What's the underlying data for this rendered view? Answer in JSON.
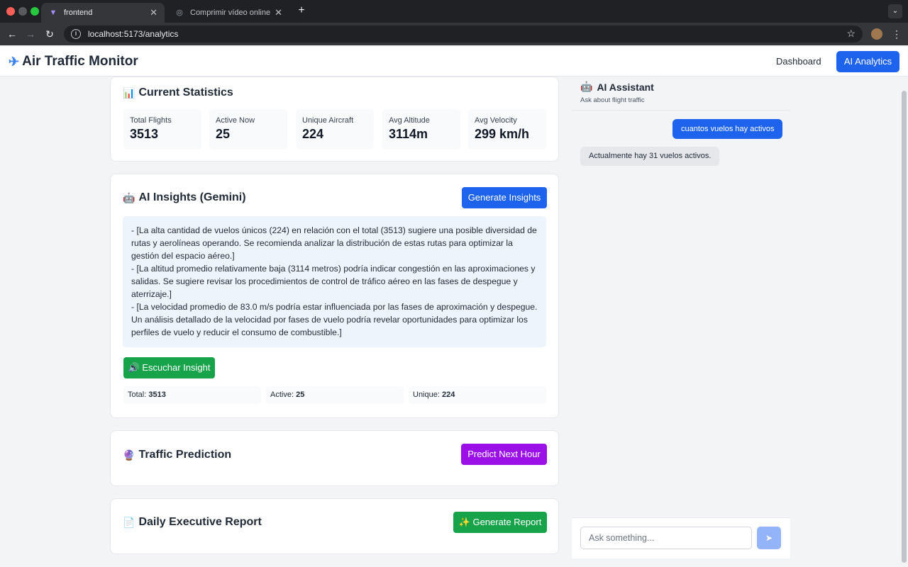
{
  "browser": {
    "tabs": [
      {
        "label": "frontend",
        "active": true
      },
      {
        "label": "Comprimir vídeo online — Re",
        "active": false
      }
    ],
    "url": "localhost:5173/analytics"
  },
  "header": {
    "brand": "Air Traffic Monitor",
    "nav": [
      {
        "label": "Dashboard",
        "active": false
      },
      {
        "label": "AI Analytics",
        "active": true
      }
    ]
  },
  "stats": {
    "title": "Current Statistics",
    "items": [
      {
        "label": "Total Flights",
        "value": "3513"
      },
      {
        "label": "Active Now",
        "value": "25"
      },
      {
        "label": "Unique Aircraft",
        "value": "224"
      },
      {
        "label": "Avg Altitude",
        "value": "3114m"
      },
      {
        "label": "Avg Velocity",
        "value": "299 km/h"
      }
    ]
  },
  "insights": {
    "title": "AI Insights (Gemini)",
    "generate_label": "Generate Insights",
    "lines": [
      "- [La alta cantidad de vuelos únicos (224) en relación con el total (3513) sugiere una posible diversidad de rutas y aerolíneas operando. Se recomienda analizar la distribución de estas rutas para optimizar la gestión del espacio aéreo.]",
      "- [La altitud promedio relativamente baja (3114 metros) podría indicar congestión en las aproximaciones y salidas. Se sugiere revisar los procedimientos de control de tráfico aéreo en las fases de despegue y aterrizaje.]",
      "- [La velocidad promedio de 83.0 m/s podría estar influenciada por las fases de aproximación y despegue. Un análisis detallado de la velocidad por fases de vuelo podría revelar oportunidades para optimizar los perfiles de vuelo y reducir el consumo de combustible.]"
    ],
    "listen_label": "Escuchar Insight",
    "summary": [
      {
        "label": "Total:",
        "value": "3513"
      },
      {
        "label": "Active:",
        "value": "25"
      },
      {
        "label": "Unique:",
        "value": "224"
      }
    ]
  },
  "prediction": {
    "title": "Traffic Prediction",
    "button_label": "Predict Next Hour"
  },
  "report": {
    "title": "Daily Executive Report",
    "button_label": "✨ Generate Report"
  },
  "assistant": {
    "title": "AI Assistant",
    "subtitle": "Ask about flight traffic",
    "messages": [
      {
        "role": "user",
        "text": "cuantos vuelos hay activos"
      },
      {
        "role": "assistant",
        "text": "Actualmente hay 31 vuelos activos."
      }
    ],
    "input_placeholder": "Ask something...",
    "send_icon": "send-arrow"
  },
  "colors": {
    "primary": "#1d63ed",
    "success": "#16a34a",
    "purple": "#9b10e6",
    "send_disabled": "#93b4f8"
  }
}
